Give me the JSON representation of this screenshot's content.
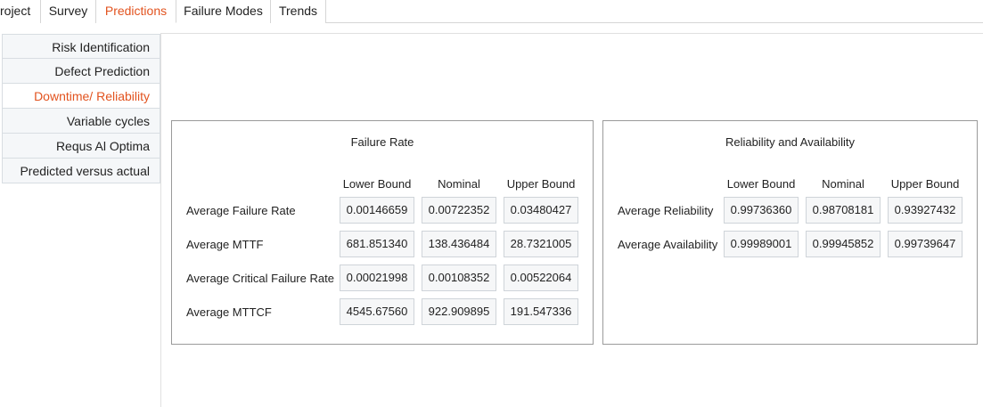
{
  "tabs": [
    {
      "label": "roject",
      "active": false
    },
    {
      "label": "Survey",
      "active": false
    },
    {
      "label": "Predictions",
      "active": true
    },
    {
      "label": "Failure Modes",
      "active": false
    },
    {
      "label": "Trends",
      "active": false
    }
  ],
  "sidebar": {
    "items": [
      {
        "label": "Risk Identification",
        "active": false
      },
      {
        "label": "Defect Prediction",
        "active": false
      },
      {
        "label": "Downtime/ Reliability",
        "active": true
      },
      {
        "label": "Variable cycles",
        "active": false
      },
      {
        "label": "Requs Al Optima",
        "active": false
      },
      {
        "label": "Predicted versus actual",
        "active": false
      }
    ]
  },
  "failure_rate": {
    "title": "Failure Rate",
    "columns": [
      "Lower Bound",
      "Nominal",
      "Upper Bound"
    ],
    "rows": [
      {
        "label": "Average Failure Rate",
        "values": [
          "0.00146659",
          "0.00722352",
          "0.03480427"
        ]
      },
      {
        "label": "Average MTTF",
        "values": [
          "681.851340",
          "138.436484",
          "28.7321005"
        ]
      },
      {
        "label": "Average Critical Failure Rate",
        "values": [
          "0.00021998",
          "0.00108352",
          "0.00522064"
        ]
      },
      {
        "label": "Average MTTCF",
        "values": [
          "4545.67560",
          "922.909895",
          "191.547336"
        ]
      }
    ]
  },
  "reliability": {
    "title": "Reliability and Availability",
    "columns": [
      "Lower Bound",
      "Nominal",
      "Upper Bound"
    ],
    "rows": [
      {
        "label": "Average Reliability",
        "values": [
          "0.99736360",
          "0.98708181",
          "0.93927432"
        ]
      },
      {
        "label": "Average Availability",
        "values": [
          "0.99989001",
          "0.99945852",
          "0.99739647"
        ]
      }
    ]
  },
  "colors": {
    "accent": "#e2531f",
    "panel_border": "#9a9a9a",
    "cell_bg": "#f6f7f8"
  }
}
